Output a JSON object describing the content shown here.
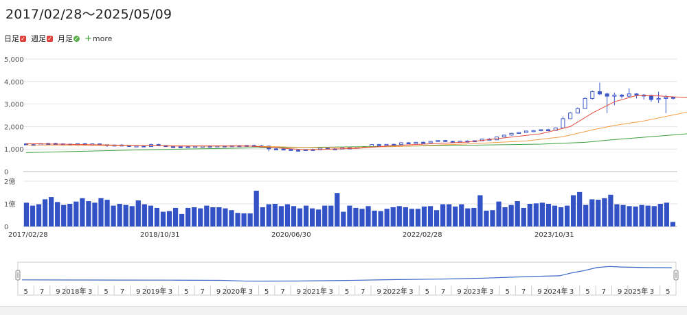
{
  "header": {
    "title": "2017/02/28〜2025/05/09"
  },
  "toggles": [
    {
      "label": "日足",
      "mark": "✓",
      "shape": "square",
      "color": "#e0413a"
    },
    {
      "label": "週足",
      "mark": "✓",
      "shape": "square",
      "color": "#e0413a"
    },
    {
      "label": "月足",
      "mark": "✓",
      "shape": "circle",
      "color": "#5bb04a"
    }
  ],
  "more": {
    "plus": "+",
    "label": "more"
  },
  "chart_data": {
    "type": "candlestick",
    "price_axis": {
      "ticks": [
        0,
        1000,
        2000,
        3000,
        4000,
        5000
      ],
      "tick_labels": [
        "0",
        "1,000",
        "2,000",
        "3,000",
        "4,000",
        "5,000"
      ],
      "ylim": [
        0,
        5000
      ]
    },
    "volume_axis": {
      "ticks": [
        0,
        100000000,
        200000000
      ],
      "tick_labels": [
        "0",
        "1億",
        "2億"
      ],
      "ylim": [
        0,
        200000000
      ]
    },
    "x_labels": [
      "2017/02/28",
      "2018/10/31",
      "2020/06/30",
      "2022/02/28",
      "2023/10/31"
    ],
    "colors": {
      "candle": "#3a56c8",
      "volume": "#3352c6",
      "ma_short": "#e74c3c",
      "ma_mid": "#f39c45",
      "ma_long": "#3ca03c",
      "navigator": "#3a66c8"
    },
    "candles": [
      [
        1230,
        1260,
        1180,
        1200
      ],
      [
        1200,
        1230,
        1150,
        1180
      ],
      [
        1180,
        1260,
        1160,
        1240
      ],
      [
        1240,
        1280,
        1200,
        1250
      ],
      [
        1250,
        1280,
        1210,
        1230
      ],
      [
        1230,
        1260,
        1190,
        1220
      ],
      [
        1220,
        1240,
        1170,
        1200
      ],
      [
        1200,
        1260,
        1180,
        1240
      ],
      [
        1240,
        1260,
        1190,
        1210
      ],
      [
        1210,
        1250,
        1180,
        1230
      ],
      [
        1230,
        1250,
        1170,
        1190
      ],
      [
        1190,
        1200,
        1100,
        1150
      ],
      [
        1150,
        1200,
        1120,
        1180
      ],
      [
        1180,
        1220,
        1140,
        1160
      ],
      [
        1160,
        1180,
        1100,
        1120
      ],
      [
        1120,
        1160,
        1090,
        1140
      ],
      [
        1140,
        1160,
        1080,
        1110
      ],
      [
        1110,
        1240,
        1100,
        1200
      ],
      [
        1200,
        1240,
        1140,
        1160
      ],
      [
        1160,
        1180,
        1090,
        1110
      ],
      [
        1110,
        1140,
        1060,
        1100
      ],
      [
        1100,
        1120,
        1050,
        1070
      ],
      [
        1070,
        1120,
        1060,
        1100
      ],
      [
        1100,
        1140,
        1080,
        1120
      ],
      [
        1120,
        1150,
        1090,
        1130
      ],
      [
        1130,
        1170,
        1100,
        1120
      ],
      [
        1120,
        1160,
        1090,
        1140
      ],
      [
        1140,
        1160,
        1100,
        1120
      ],
      [
        1120,
        1160,
        1100,
        1150
      ],
      [
        1150,
        1180,
        1110,
        1130
      ],
      [
        1130,
        1180,
        1100,
        1160
      ],
      [
        1160,
        1200,
        1120,
        1140
      ],
      [
        1140,
        1180,
        1110,
        1130
      ],
      [
        1130,
        1150,
        900,
        1010
      ],
      [
        1010,
        1050,
        980,
        1000
      ],
      [
        1000,
        1040,
        960,
        980
      ],
      [
        980,
        1010,
        930,
        950
      ],
      [
        950,
        980,
        910,
        930
      ],
      [
        930,
        1000,
        910,
        980
      ],
      [
        980,
        1020,
        950,
        970
      ],
      [
        970,
        1060,
        960,
        1040
      ],
      [
        1040,
        1070,
        990,
        1010
      ],
      [
        1010,
        1040,
        980,
        1000
      ],
      [
        1000,
        1060,
        990,
        1050
      ],
      [
        1050,
        1080,
        1020,
        1040
      ],
      [
        1040,
        1090,
        1030,
        1080
      ],
      [
        1080,
        1130,
        1060,
        1110
      ],
      [
        1110,
        1220,
        1100,
        1200
      ],
      [
        1200,
        1230,
        1150,
        1170
      ],
      [
        1170,
        1220,
        1160,
        1210
      ],
      [
        1210,
        1240,
        1180,
        1200
      ],
      [
        1200,
        1300,
        1190,
        1280
      ],
      [
        1280,
        1310,
        1230,
        1250
      ],
      [
        1250,
        1310,
        1240,
        1300
      ],
      [
        1300,
        1330,
        1260,
        1280
      ],
      [
        1280,
        1360,
        1270,
        1340
      ],
      [
        1340,
        1390,
        1320,
        1380
      ],
      [
        1380,
        1400,
        1320,
        1340
      ],
      [
        1340,
        1370,
        1290,
        1310
      ],
      [
        1310,
        1370,
        1300,
        1350
      ],
      [
        1350,
        1390,
        1320,
        1340
      ],
      [
        1340,
        1380,
        1320,
        1370
      ],
      [
        1370,
        1470,
        1360,
        1440
      ],
      [
        1440,
        1480,
        1400,
        1410
      ],
      [
        1410,
        1560,
        1400,
        1540
      ],
      [
        1540,
        1640,
        1530,
        1620
      ],
      [
        1620,
        1720,
        1600,
        1700
      ],
      [
        1700,
        1760,
        1680,
        1740
      ],
      [
        1740,
        1820,
        1720,
        1800
      ],
      [
        1800,
        1840,
        1760,
        1820
      ],
      [
        1820,
        1880,
        1780,
        1860
      ],
      [
        1860,
        1900,
        1800,
        1830
      ],
      [
        1830,
        1960,
        1820,
        1940
      ],
      [
        1940,
        2450,
        1930,
        2350
      ],
      [
        2350,
        2650,
        2340,
        2600
      ],
      [
        2600,
        2850,
        2580,
        2800
      ],
      [
        2800,
        3300,
        2790,
        3250
      ],
      [
        3250,
        3600,
        3200,
        3550
      ],
      [
        3550,
        3950,
        3400,
        3450
      ],
      [
        3450,
        3500,
        2600,
        3350
      ],
      [
        3350,
        3500,
        2950,
        3400
      ],
      [
        3400,
        3450,
        3250,
        3350
      ],
      [
        3350,
        3700,
        3300,
        3450
      ],
      [
        3450,
        3480,
        3250,
        3400
      ],
      [
        3400,
        3450,
        3200,
        3380
      ],
      [
        3380,
        3420,
        3100,
        3200
      ],
      [
        3200,
        3550,
        3050,
        3250
      ],
      [
        3250,
        3400,
        2600,
        3300
      ],
      [
        3300,
        3330,
        3200,
        3260
      ]
    ],
    "ma_short": [
      [
        0,
        1240
      ],
      [
        10,
        1190
      ],
      [
        20,
        1130
      ],
      [
        30,
        1140
      ],
      [
        33,
        1080
      ],
      [
        38,
        970
      ],
      [
        45,
        1030
      ],
      [
        50,
        1160
      ],
      [
        60,
        1310
      ],
      [
        70,
        1680
      ],
      [
        74,
        2000
      ],
      [
        77,
        2600
      ],
      [
        80,
        3100
      ],
      [
        83,
        3380
      ],
      [
        86,
        3360
      ],
      [
        90,
        3280
      ]
    ],
    "ma_mid": [
      [
        0,
        1180
      ],
      [
        15,
        1150
      ],
      [
        30,
        1130
      ],
      [
        40,
        1060
      ],
      [
        50,
        1110
      ],
      [
        60,
        1230
      ],
      [
        68,
        1360
      ],
      [
        73,
        1550
      ],
      [
        77,
        1850
      ],
      [
        80,
        2050
      ],
      [
        84,
        2250
      ],
      [
        90,
        2650
      ]
    ],
    "ma_long": [
      [
        0,
        840
      ],
      [
        15,
        960
      ],
      [
        30,
        1050
      ],
      [
        45,
        1100
      ],
      [
        60,
        1170
      ],
      [
        70,
        1220
      ],
      [
        76,
        1300
      ],
      [
        80,
        1420
      ],
      [
        90,
        1680
      ]
    ],
    "volume": [
      105,
      92,
      98,
      120,
      130,
      108,
      95,
      100,
      110,
      125,
      112,
      105,
      125,
      118,
      92,
      100,
      95,
      90,
      115,
      98,
      92,
      82,
      65,
      68,
      82,
      55,
      82,
      85,
      80,
      92,
      85,
      85,
      80,
      72,
      60,
      58,
      58,
      158,
      85,
      98,
      100,
      90,
      98,
      90,
      80,
      92,
      80,
      75,
      92,
      92,
      148,
      65,
      92,
      82,
      78,
      90,
      70,
      68,
      78,
      85,
      90,
      85,
      78,
      78,
      88,
      90,
      72,
      98,
      98,
      88,
      98,
      80,
      82,
      138,
      70,
      72,
      110,
      85,
      95,
      112,
      82,
      100,
      102,
      105,
      100,
      92,
      85,
      92,
      138,
      152,
      95,
      120,
      118,
      125,
      140,
      98,
      95,
      90,
      88,
      95,
      92,
      90,
      100,
      105,
      20
    ],
    "navigator": {
      "labels": [
        "5",
        "7",
        "9",
        "2018年",
        "3",
        "5",
        "7",
        "9",
        "2019年",
        "3",
        "5",
        "7",
        "9",
        "2020年",
        "3",
        "5",
        "7",
        "9",
        "2021年",
        "3",
        "5",
        "7",
        "9",
        "2022年",
        "3",
        "5",
        "7",
        "9",
        "2023年",
        "3",
        "5",
        "7",
        "9",
        "2024年",
        "3",
        "5",
        "7",
        "9",
        "2025年",
        "3",
        "5"
      ],
      "line": [
        [
          0,
          1200
        ],
        [
          8,
          1180
        ],
        [
          16,
          1160
        ],
        [
          24,
          1150
        ],
        [
          32,
          1120
        ],
        [
          36,
          980
        ],
        [
          44,
          1000
        ],
        [
          52,
          1100
        ],
        [
          60,
          1250
        ],
        [
          68,
          1350
        ],
        [
          74,
          1500
        ],
        [
          78,
          1650
        ],
        [
          82,
          1800
        ],
        [
          86,
          1900
        ],
        [
          88,
          2400
        ],
        [
          90,
          2800
        ],
        [
          92,
          3300
        ],
        [
          94,
          3500
        ],
        [
          96,
          3400
        ],
        [
          98,
          3350
        ],
        [
          100,
          3300
        ],
        [
          104,
          3280
        ]
      ]
    }
  }
}
